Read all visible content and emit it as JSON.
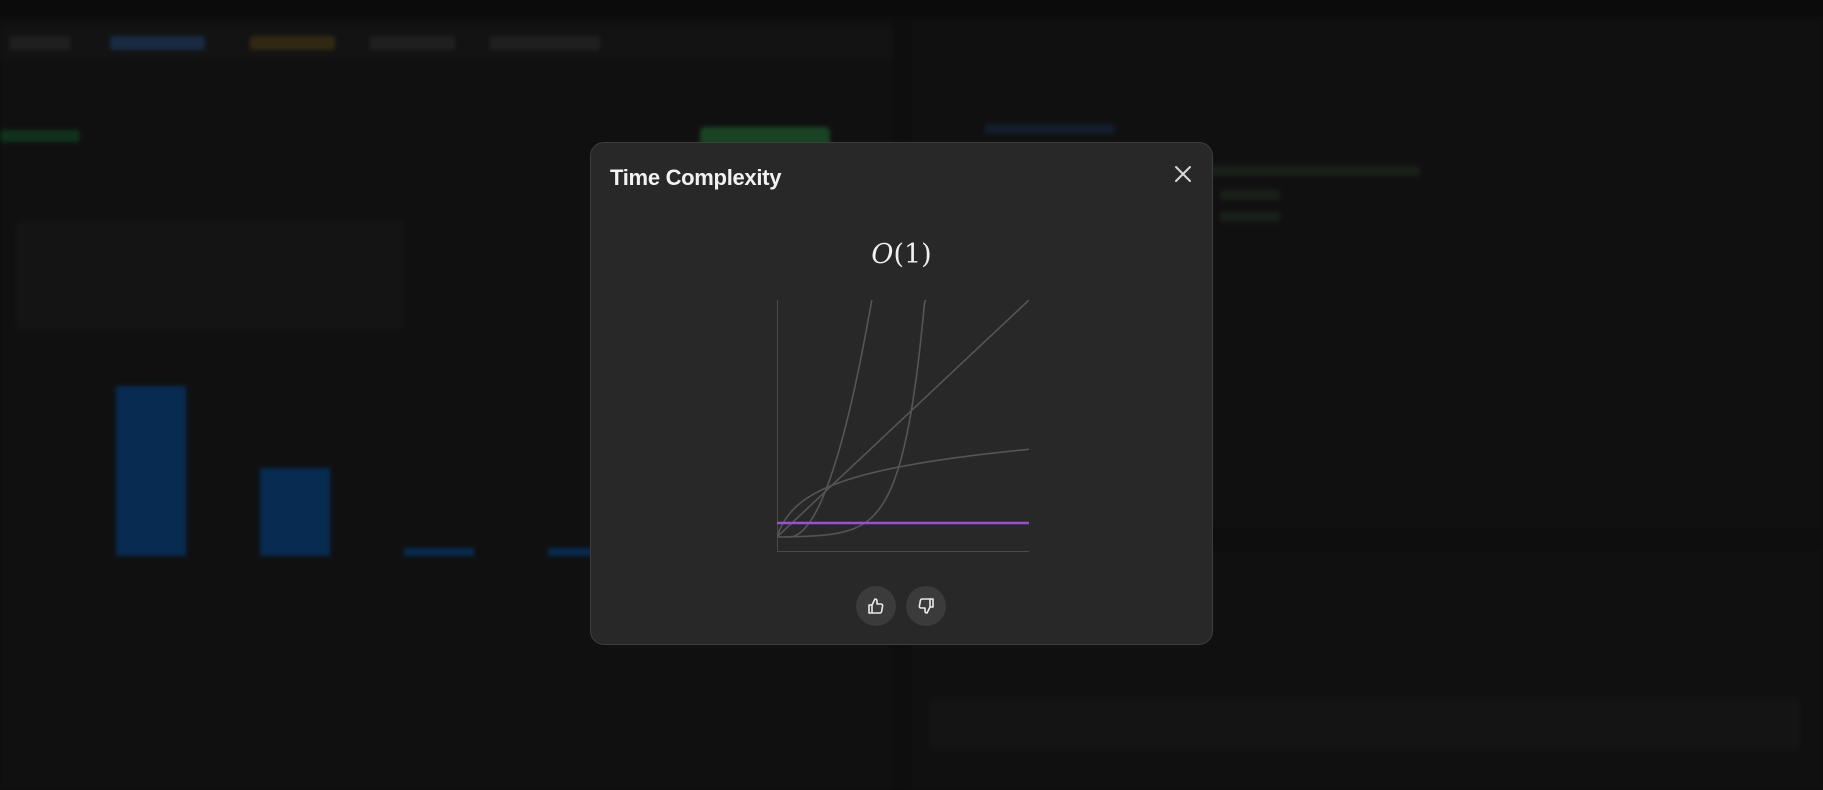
{
  "modal": {
    "title": "Time Complexity",
    "complexity": {
      "notation": "O",
      "argument": "(1)"
    },
    "close_icon": "close-icon",
    "feedback": {
      "like_icon": "thumbs-up-icon",
      "dislike_icon": "thumbs-down-icon"
    }
  },
  "chart_data": {
    "type": "line",
    "title": "",
    "xlabel": "",
    "ylabel": "",
    "grid": false,
    "highlighted_series": "O(1)",
    "series": [
      {
        "key": "constant",
        "color": "#9b4fd1",
        "highlighted": true
      },
      {
        "key": "log",
        "color": "#555555",
        "highlighted": false
      },
      {
        "key": "linear",
        "color": "#555555",
        "highlighted": false
      },
      {
        "key": "quadratic",
        "color": "#555555",
        "highlighted": false
      },
      {
        "key": "exponential",
        "color": "#555555",
        "highlighted": false
      }
    ]
  },
  "colors": {
    "background": "#1a1a1a",
    "modal_bg": "#282828",
    "accent_purple": "#9b4fd1",
    "curve_gray": "#555555"
  }
}
